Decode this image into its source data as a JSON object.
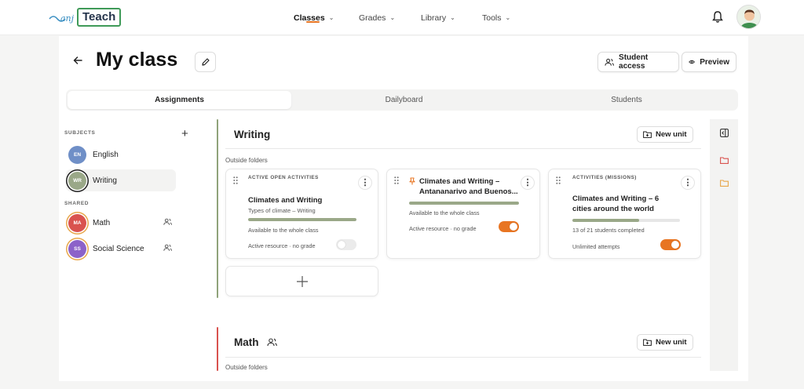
{
  "brand": {
    "logo_text": "Teach",
    "logo_script": "anj",
    "accent": "#e87522",
    "green": "#3f9a58"
  },
  "nav": {
    "items": [
      "Classes",
      "Grades",
      "Library",
      "Tools"
    ],
    "active": "Classes"
  },
  "header": {
    "title": "My class",
    "student_access": "Student access",
    "preview": "Preview"
  },
  "tabs": {
    "items": [
      "Assignments",
      "Dailyboard",
      "Students"
    ],
    "active": "Assignments"
  },
  "sidebar": {
    "subjects_label": "SUBJECTS",
    "shared_label": "SHARED",
    "subjects": [
      {
        "abbr": "EN",
        "name": "English",
        "color": "#6f8fc7"
      },
      {
        "abbr": "WR",
        "name": "Writing",
        "color": "#9aa888",
        "selected": true
      }
    ],
    "shared": [
      {
        "abbr": "MA",
        "name": "Math",
        "color": "#d9534f",
        "ring": "#e8a64a"
      },
      {
        "abbr": "SS",
        "name": "Social Science",
        "color": "#8c62c9",
        "ring": "#e8a64a"
      }
    ]
  },
  "writing_section": {
    "title": "Writing",
    "new_unit": "New unit",
    "outside_folders": "Outside folders",
    "cards": [
      {
        "type": "ACTIVE OPEN ACTIVITIES",
        "title": "Climates and Writing",
        "subtitle": "Types of climate – Writing",
        "progress": 1.0,
        "availability": "Available to the whole class",
        "status": "Active resource · no grade",
        "toggle_on": false
      },
      {
        "title_line1": "Climates and Writing –",
        "title_line2": "Antananarivo and Buenos...",
        "pinned": true,
        "progress": 1.0,
        "availability": "Available to the whole class",
        "status": "Active resource · no grade",
        "toggle_on": true
      },
      {
        "type": "ACTIVITIES (MISSIONS)",
        "title_line1": "Climates and Writing – 6",
        "title_line2": "cities around the world",
        "progress": 0.62,
        "completed": "13 of 21 students completed",
        "status": "Unlimited attempts",
        "toggle_on": true
      }
    ]
  },
  "math_section": {
    "title": "Math",
    "new_unit": "New unit",
    "outside_folders": "Outside folders"
  }
}
